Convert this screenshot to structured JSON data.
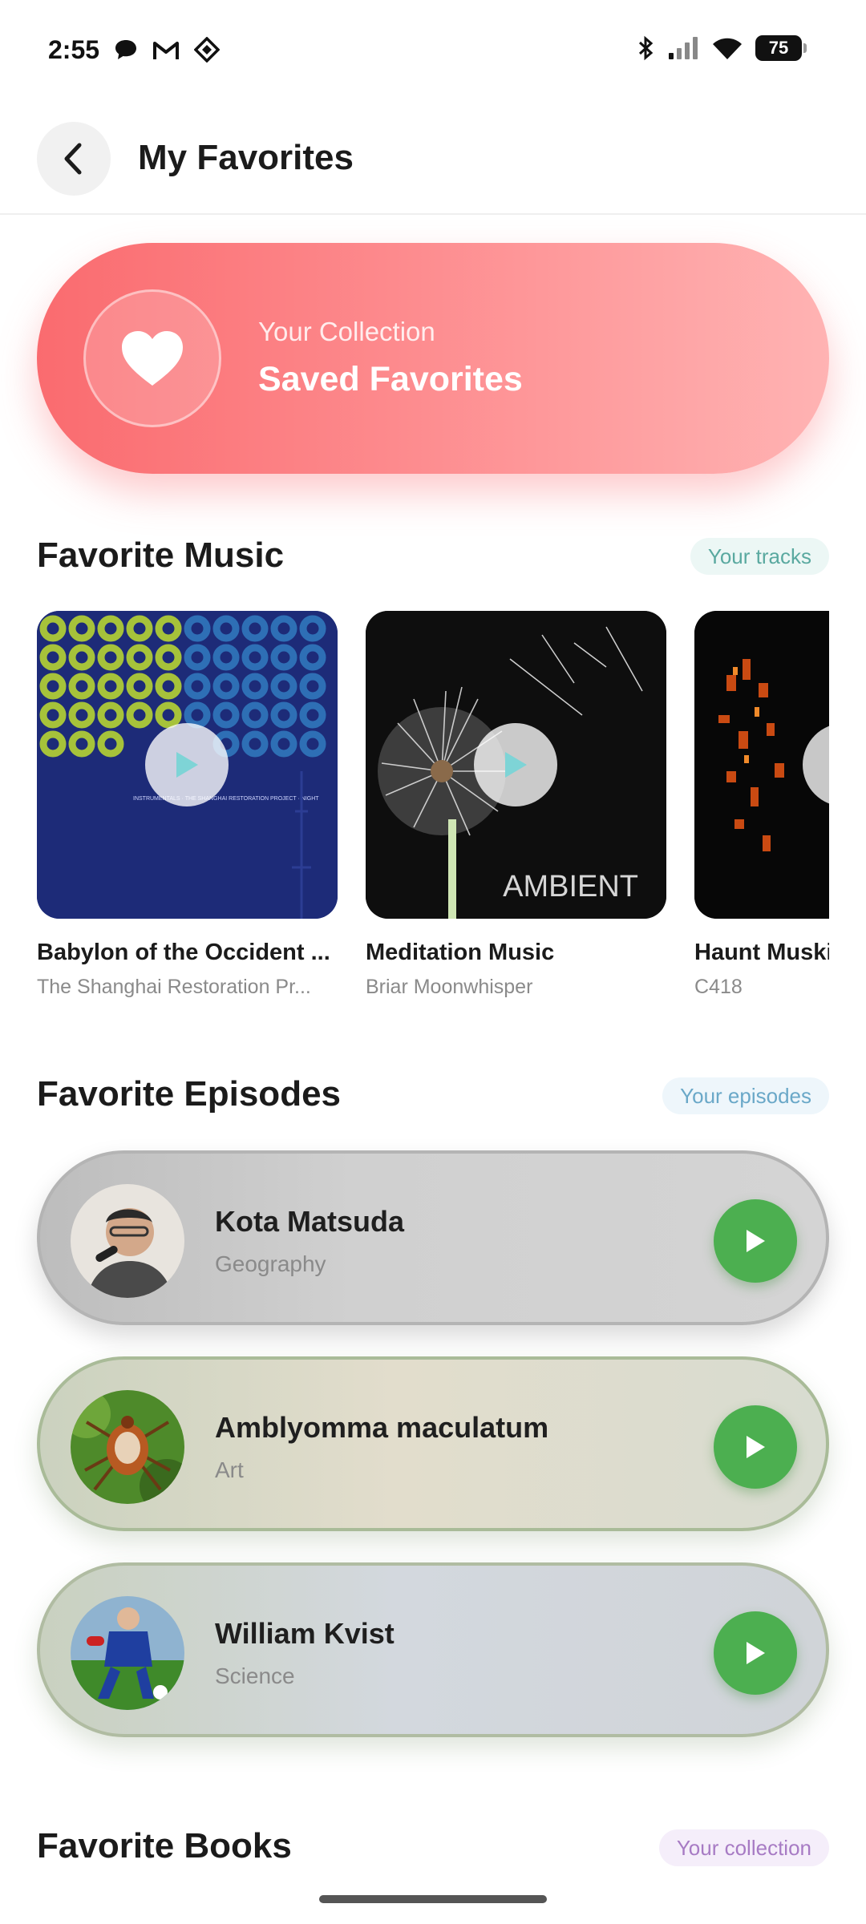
{
  "status": {
    "time": "2:55",
    "battery": "75"
  },
  "header": {
    "title": "My Favorites"
  },
  "hero": {
    "subtitle": "Your Collection",
    "title": "Saved Favorites"
  },
  "music_section": {
    "title": "Favorite Music",
    "pill": "Your tracks",
    "items": [
      {
        "title": "Babylon of the Occident ...",
        "artist": "The Shanghai Restoration Pr...",
        "art_text": "INSTRUMENTALS · THE SHANGHAI RESTORATION PROJECT · NIGHT"
      },
      {
        "title": "Meditation Music",
        "artist": "Briar Moonwhisper",
        "art_text": "AMBIENT"
      },
      {
        "title": "Haunt Muski",
        "artist": "C418"
      }
    ]
  },
  "episodes_section": {
    "title": "Favorite Episodes",
    "pill": "Your episodes",
    "items": [
      {
        "name": "Kota Matsuda",
        "category": "Geography"
      },
      {
        "name": "Amblyomma maculatum",
        "category": "Art"
      },
      {
        "name": "William Kvist",
        "category": "Science"
      }
    ]
  },
  "books_section": {
    "title": "Favorite Books",
    "pill": "Your collection"
  },
  "colors": {
    "hero_start": "#fa6b6f",
    "hero_end": "#ffb3b3",
    "play_green": "#4caf50",
    "music_pill_text": "#5aa9a0",
    "episodes_pill_text": "#6aa8c8",
    "books_pill_text": "#a77bc4"
  }
}
